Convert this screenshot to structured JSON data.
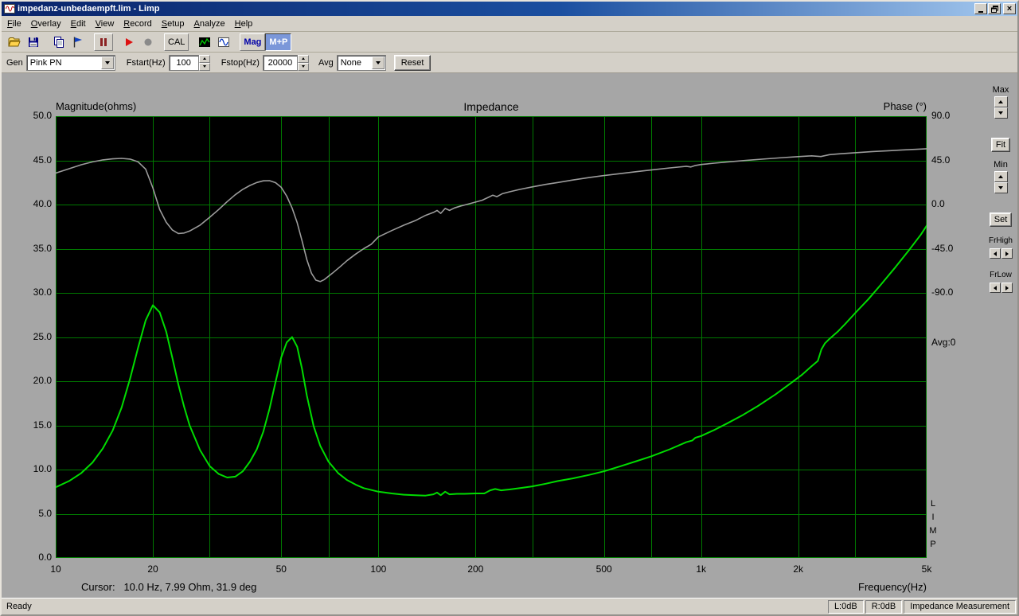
{
  "window": {
    "title": "impedanz-unbedaempft.lim - Limp"
  },
  "menu": {
    "items": [
      "File",
      "Overlay",
      "Edit",
      "View",
      "Record",
      "Setup",
      "Analyze",
      "Help"
    ]
  },
  "toolbar": {
    "cal_label": "CAL",
    "mag_label": "Mag",
    "mp_label": "M+P",
    "icons": [
      "open-folder",
      "save",
      "copy",
      "overlay-flag",
      "pause",
      "play",
      "record",
      "spectrum",
      "signal-generator"
    ]
  },
  "genbar": {
    "gen_label": "Gen",
    "gen_value": "Pink PN",
    "fstart_label": "Fstart(Hz)",
    "fstart_value": "100",
    "fstop_label": "Fstop(Hz)",
    "fstop_value": "20000",
    "avg_label": "Avg",
    "avg_value": "None",
    "reset_label": "Reset"
  },
  "right_panel": {
    "max_label": "Max",
    "fit_label": "Fit",
    "min_label": "Min",
    "set_label": "Set",
    "frhigh_label": "FrHigh",
    "frlow_label": "FrLow"
  },
  "statusbar": {
    "ready": "Ready",
    "left_level": "L:0dB",
    "right_level": "R:0dB",
    "mode": "Impedance Measurement"
  },
  "chart": {
    "cursor_text": "Cursor:   10.0 Hz, 7.99 Ohm, 31.9 deg",
    "avg_text": "Avg:0",
    "limp_letters": [
      "L",
      "I",
      "M",
      "P"
    ]
  },
  "chart_data": {
    "type": "line",
    "title": "Impedance",
    "background": "#000000",
    "grid_color": "#007800",
    "left_axis": {
      "label": "Magnitude(ohms)",
      "min": 0,
      "max": 50,
      "grid_values": [
        5,
        10,
        15,
        20,
        25,
        30,
        35,
        40,
        45
      ],
      "ticks": [
        {
          "value": 50,
          "label": "50.0"
        },
        {
          "value": 45,
          "label": "45.0"
        },
        {
          "value": 40,
          "label": "40.0"
        },
        {
          "value": 35,
          "label": "35.0"
        },
        {
          "value": 30,
          "label": "30.0"
        },
        {
          "value": 25,
          "label": "25.0"
        },
        {
          "value": 20,
          "label": "20.0"
        },
        {
          "value": 15,
          "label": "15.0"
        },
        {
          "value": 10,
          "label": "10.0"
        },
        {
          "value": 5,
          "label": "5.0"
        },
        {
          "value": 0,
          "label": "0.0"
        }
      ]
    },
    "right_axis": {
      "label": "Phase (°)",
      "top_value": 90,
      "deg_per_division": 45,
      "ticks": [
        {
          "value": 90,
          "label": "90.0"
        },
        {
          "value": 45,
          "label": "45.0"
        },
        {
          "value": 0,
          "label": "0.0"
        },
        {
          "value": -45,
          "label": "-45.0"
        },
        {
          "value": -90,
          "label": "-90.0"
        }
      ]
    },
    "x_axis": {
      "label": "Frequency(Hz)",
      "scale": "log",
      "min": 10,
      "max": 5000,
      "grid_lines": [
        20,
        30,
        50,
        70,
        100,
        200,
        300,
        500,
        700,
        1000,
        2000,
        3000
      ],
      "ticks": [
        {
          "value": 10,
          "label": "10"
        },
        {
          "value": 20,
          "label": "20"
        },
        {
          "value": 50,
          "label": "50"
        },
        {
          "value": 100,
          "label": "100"
        },
        {
          "value": 200,
          "label": "200"
        },
        {
          "value": 500,
          "label": "500"
        },
        {
          "value": 1000,
          "label": "1k"
        },
        {
          "value": 2000,
          "label": "2k"
        },
        {
          "value": 5000,
          "label": "5k"
        }
      ]
    },
    "series": [
      {
        "name": "impedance-magnitude",
        "axis": "left",
        "color": "#00dc00",
        "stroke_width": 2,
        "points": [
          [
            10,
            8.0
          ],
          [
            11,
            8.7
          ],
          [
            12,
            9.6
          ],
          [
            13,
            10.8
          ],
          [
            14,
            12.4
          ],
          [
            15,
            14.4
          ],
          [
            16,
            17.0
          ],
          [
            17,
            20.3
          ],
          [
            18,
            23.8
          ],
          [
            19,
            26.9
          ],
          [
            20,
            28.6
          ],
          [
            21,
            27.8
          ],
          [
            22,
            25.6
          ],
          [
            23,
            22.6
          ],
          [
            24,
            19.6
          ],
          [
            25,
            17.1
          ],
          [
            26,
            15.0
          ],
          [
            28,
            12.2
          ],
          [
            30,
            10.4
          ],
          [
            32,
            9.5
          ],
          [
            34,
            9.1
          ],
          [
            36,
            9.2
          ],
          [
            38,
            9.8
          ],
          [
            40,
            10.9
          ],
          [
            42,
            12.3
          ],
          [
            44,
            14.3
          ],
          [
            46,
            16.9
          ],
          [
            48,
            19.9
          ],
          [
            50,
            22.7
          ],
          [
            52,
            24.4
          ],
          [
            54,
            25.0
          ],
          [
            56,
            23.9
          ],
          [
            58,
            21.4
          ],
          [
            60,
            18.4
          ],
          [
            63,
            14.9
          ],
          [
            66,
            12.7
          ],
          [
            70,
            10.9
          ],
          [
            75,
            9.6
          ],
          [
            80,
            8.8
          ],
          [
            85,
            8.3
          ],
          [
            90,
            7.9
          ],
          [
            100,
            7.5
          ],
          [
            110,
            7.3
          ],
          [
            120,
            7.15
          ],
          [
            130,
            7.1
          ],
          [
            140,
            7.05
          ],
          [
            148,
            7.2
          ],
          [
            152,
            7.4
          ],
          [
            156,
            7.1
          ],
          [
            161,
            7.5
          ],
          [
            166,
            7.2
          ],
          [
            175,
            7.25
          ],
          [
            185,
            7.25
          ],
          [
            200,
            7.3
          ],
          [
            213,
            7.3
          ],
          [
            222,
            7.65
          ],
          [
            230,
            7.8
          ],
          [
            240,
            7.65
          ],
          [
            255,
            7.75
          ],
          [
            275,
            7.9
          ],
          [
            300,
            8.1
          ],
          [
            330,
            8.4
          ],
          [
            360,
            8.7
          ],
          [
            400,
            9.0
          ],
          [
            450,
            9.4
          ],
          [
            500,
            9.8
          ],
          [
            560,
            10.35
          ],
          [
            630,
            10.95
          ],
          [
            700,
            11.5
          ],
          [
            800,
            12.3
          ],
          [
            900,
            13.1
          ],
          [
            940,
            13.3
          ],
          [
            960,
            13.6
          ],
          [
            1000,
            13.8
          ],
          [
            1100,
            14.5
          ],
          [
            1200,
            15.2
          ],
          [
            1350,
            16.2
          ],
          [
            1500,
            17.2
          ],
          [
            1700,
            18.5
          ],
          [
            1900,
            19.8
          ],
          [
            2050,
            20.7
          ],
          [
            2200,
            21.7
          ],
          [
            2300,
            22.3
          ],
          [
            2360,
            23.6
          ],
          [
            2420,
            24.3
          ],
          [
            2500,
            24.8
          ],
          [
            2650,
            25.6
          ],
          [
            2800,
            26.5
          ],
          [
            3000,
            27.7
          ],
          [
            3300,
            29.3
          ],
          [
            3600,
            30.9
          ],
          [
            4000,
            32.9
          ],
          [
            4400,
            34.8
          ],
          [
            4800,
            36.6
          ],
          [
            5000,
            37.6
          ]
        ]
      },
      {
        "name": "impedance-phase",
        "axis": "right",
        "color": "#9c9c9c",
        "stroke_width": 1.6,
        "points": [
          [
            10,
            32
          ],
          [
            11,
            36.5
          ],
          [
            12,
            40.5
          ],
          [
            13,
            43.5
          ],
          [
            14,
            45.5
          ],
          [
            15,
            46.5
          ],
          [
            16,
            47
          ],
          [
            17,
            46.3
          ],
          [
            18,
            43.5
          ],
          [
            19,
            36
          ],
          [
            20,
            17
          ],
          [
            21,
            -5
          ],
          [
            22,
            -18
          ],
          [
            23,
            -26
          ],
          [
            24,
            -29.5
          ],
          [
            25,
            -29
          ],
          [
            26,
            -27
          ],
          [
            28,
            -21
          ],
          [
            30,
            -13
          ],
          [
            32,
            -5
          ],
          [
            34,
            3
          ],
          [
            36,
            10
          ],
          [
            38,
            15.5
          ],
          [
            40,
            19.5
          ],
          [
            42,
            22.5
          ],
          [
            44,
            24.2
          ],
          [
            46,
            24.3
          ],
          [
            48,
            22.3
          ],
          [
            50,
            17.5
          ],
          [
            52,
            8.5
          ],
          [
            54,
            -3.5
          ],
          [
            56,
            -18.5
          ],
          [
            58,
            -37
          ],
          [
            60,
            -56
          ],
          [
            62,
            -70
          ],
          [
            64,
            -77
          ],
          [
            66,
            -78.5
          ],
          [
            68,
            -76.5
          ],
          [
            72,
            -70
          ],
          [
            76,
            -63.5
          ],
          [
            80,
            -57
          ],
          [
            85,
            -50.5
          ],
          [
            90,
            -45
          ],
          [
            95,
            -40.5
          ],
          [
            100,
            -33
          ],
          [
            110,
            -26.5
          ],
          [
            120,
            -21
          ],
          [
            130,
            -16.5
          ],
          [
            140,
            -11
          ],
          [
            148,
            -8
          ],
          [
            152,
            -6
          ],
          [
            156,
            -9
          ],
          [
            161,
            -4
          ],
          [
            166,
            -6
          ],
          [
            172,
            -3.5
          ],
          [
            180,
            -1.5
          ],
          [
            190,
            0.5
          ],
          [
            200,
            2.5
          ],
          [
            210,
            4.5
          ],
          [
            218,
            7
          ],
          [
            226,
            9.5
          ],
          [
            233,
            8
          ],
          [
            242,
            11
          ],
          [
            255,
            13
          ],
          [
            275,
            15.5
          ],
          [
            300,
            18
          ],
          [
            330,
            20.5
          ],
          [
            360,
            22.5
          ],
          [
            400,
            25
          ],
          [
            450,
            27.5
          ],
          [
            500,
            29.5
          ],
          [
            560,
            31.5
          ],
          [
            630,
            33.5
          ],
          [
            700,
            35.2
          ],
          [
            800,
            37.3
          ],
          [
            900,
            39
          ],
          [
            930,
            38.3
          ],
          [
            960,
            39.8
          ],
          [
            1000,
            40.8
          ],
          [
            1100,
            42.2
          ],
          [
            1200,
            43.3
          ],
          [
            1400,
            45.2
          ],
          [
            1600,
            46.6
          ],
          [
            1800,
            47.8
          ],
          [
            2000,
            48.8
          ],
          [
            2200,
            49.6
          ],
          [
            2350,
            48.9
          ],
          [
            2500,
            50.8
          ],
          [
            2700,
            51.7
          ],
          [
            3000,
            52.8
          ],
          [
            3400,
            54
          ],
          [
            3800,
            54.8
          ],
          [
            4200,
            55.6
          ],
          [
            4600,
            56.2
          ],
          [
            5000,
            56.8
          ]
        ]
      }
    ]
  }
}
